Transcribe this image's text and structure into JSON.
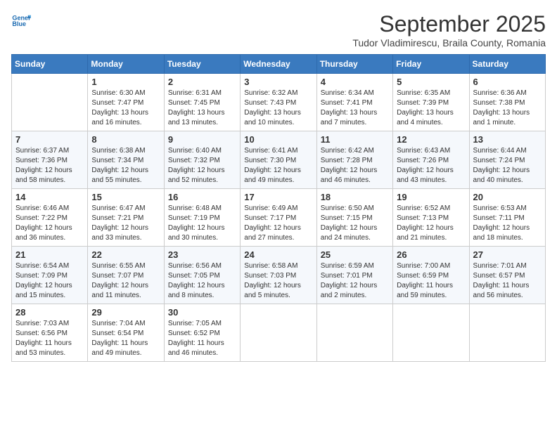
{
  "logo": {
    "line1": "General",
    "line2": "Blue"
  },
  "title": "September 2025",
  "subtitle": "Tudor Vladimirescu, Braila County, Romania",
  "headers": [
    "Sunday",
    "Monday",
    "Tuesday",
    "Wednesday",
    "Thursday",
    "Friday",
    "Saturday"
  ],
  "weeks": [
    [
      {
        "day": "",
        "info": ""
      },
      {
        "day": "1",
        "info": "Sunrise: 6:30 AM\nSunset: 7:47 PM\nDaylight: 13 hours\nand 16 minutes."
      },
      {
        "day": "2",
        "info": "Sunrise: 6:31 AM\nSunset: 7:45 PM\nDaylight: 13 hours\nand 13 minutes."
      },
      {
        "day": "3",
        "info": "Sunrise: 6:32 AM\nSunset: 7:43 PM\nDaylight: 13 hours\nand 10 minutes."
      },
      {
        "day": "4",
        "info": "Sunrise: 6:34 AM\nSunset: 7:41 PM\nDaylight: 13 hours\nand 7 minutes."
      },
      {
        "day": "5",
        "info": "Sunrise: 6:35 AM\nSunset: 7:39 PM\nDaylight: 13 hours\nand 4 minutes."
      },
      {
        "day": "6",
        "info": "Sunrise: 6:36 AM\nSunset: 7:38 PM\nDaylight: 13 hours\nand 1 minute."
      }
    ],
    [
      {
        "day": "7",
        "info": "Sunrise: 6:37 AM\nSunset: 7:36 PM\nDaylight: 12 hours\nand 58 minutes."
      },
      {
        "day": "8",
        "info": "Sunrise: 6:38 AM\nSunset: 7:34 PM\nDaylight: 12 hours\nand 55 minutes."
      },
      {
        "day": "9",
        "info": "Sunrise: 6:40 AM\nSunset: 7:32 PM\nDaylight: 12 hours\nand 52 minutes."
      },
      {
        "day": "10",
        "info": "Sunrise: 6:41 AM\nSunset: 7:30 PM\nDaylight: 12 hours\nand 49 minutes."
      },
      {
        "day": "11",
        "info": "Sunrise: 6:42 AM\nSunset: 7:28 PM\nDaylight: 12 hours\nand 46 minutes."
      },
      {
        "day": "12",
        "info": "Sunrise: 6:43 AM\nSunset: 7:26 PM\nDaylight: 12 hours\nand 43 minutes."
      },
      {
        "day": "13",
        "info": "Sunrise: 6:44 AM\nSunset: 7:24 PM\nDaylight: 12 hours\nand 40 minutes."
      }
    ],
    [
      {
        "day": "14",
        "info": "Sunrise: 6:46 AM\nSunset: 7:22 PM\nDaylight: 12 hours\nand 36 minutes."
      },
      {
        "day": "15",
        "info": "Sunrise: 6:47 AM\nSunset: 7:21 PM\nDaylight: 12 hours\nand 33 minutes."
      },
      {
        "day": "16",
        "info": "Sunrise: 6:48 AM\nSunset: 7:19 PM\nDaylight: 12 hours\nand 30 minutes."
      },
      {
        "day": "17",
        "info": "Sunrise: 6:49 AM\nSunset: 7:17 PM\nDaylight: 12 hours\nand 27 minutes."
      },
      {
        "day": "18",
        "info": "Sunrise: 6:50 AM\nSunset: 7:15 PM\nDaylight: 12 hours\nand 24 minutes."
      },
      {
        "day": "19",
        "info": "Sunrise: 6:52 AM\nSunset: 7:13 PM\nDaylight: 12 hours\nand 21 minutes."
      },
      {
        "day": "20",
        "info": "Sunrise: 6:53 AM\nSunset: 7:11 PM\nDaylight: 12 hours\nand 18 minutes."
      }
    ],
    [
      {
        "day": "21",
        "info": "Sunrise: 6:54 AM\nSunset: 7:09 PM\nDaylight: 12 hours\nand 15 minutes."
      },
      {
        "day": "22",
        "info": "Sunrise: 6:55 AM\nSunset: 7:07 PM\nDaylight: 12 hours\nand 11 minutes."
      },
      {
        "day": "23",
        "info": "Sunrise: 6:56 AM\nSunset: 7:05 PM\nDaylight: 12 hours\nand 8 minutes."
      },
      {
        "day": "24",
        "info": "Sunrise: 6:58 AM\nSunset: 7:03 PM\nDaylight: 12 hours\nand 5 minutes."
      },
      {
        "day": "25",
        "info": "Sunrise: 6:59 AM\nSunset: 7:01 PM\nDaylight: 12 hours\nand 2 minutes."
      },
      {
        "day": "26",
        "info": "Sunrise: 7:00 AM\nSunset: 6:59 PM\nDaylight: 11 hours\nand 59 minutes."
      },
      {
        "day": "27",
        "info": "Sunrise: 7:01 AM\nSunset: 6:57 PM\nDaylight: 11 hours\nand 56 minutes."
      }
    ],
    [
      {
        "day": "28",
        "info": "Sunrise: 7:03 AM\nSunset: 6:56 PM\nDaylight: 11 hours\nand 53 minutes."
      },
      {
        "day": "29",
        "info": "Sunrise: 7:04 AM\nSunset: 6:54 PM\nDaylight: 11 hours\nand 49 minutes."
      },
      {
        "day": "30",
        "info": "Sunrise: 7:05 AM\nSunset: 6:52 PM\nDaylight: 11 hours\nand 46 minutes."
      },
      {
        "day": "",
        "info": ""
      },
      {
        "day": "",
        "info": ""
      },
      {
        "day": "",
        "info": ""
      },
      {
        "day": "",
        "info": ""
      }
    ]
  ]
}
